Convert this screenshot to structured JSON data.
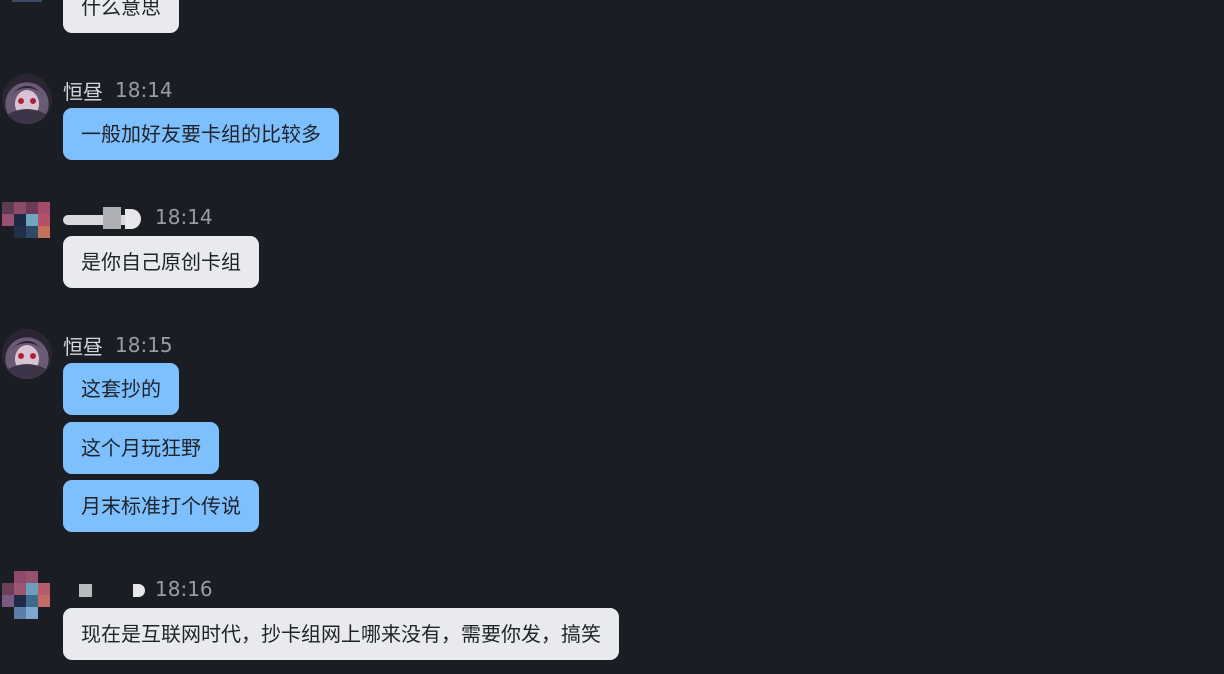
{
  "messages": [
    {
      "text": "什么意思"
    },
    {
      "sender": "恒昼",
      "time": "18:14",
      "text": "一般加好友要卡组的比较多"
    },
    {
      "time": "18:14",
      "text": "是你自己原创卡组"
    },
    {
      "sender": "恒昼",
      "time": "18:15",
      "texts": [
        "这套抄的",
        "这个月玩狂野",
        "月末标准打个传说"
      ]
    },
    {
      "time": "18:16",
      "text": "现在是互联网时代，抄卡组网上哪来没有，需要你发，搞笑"
    }
  ],
  "colors": {
    "background": "#1b1d24",
    "outgoing_bubble": "#7ec0fe",
    "incoming_bubble": "#e9eaee"
  }
}
